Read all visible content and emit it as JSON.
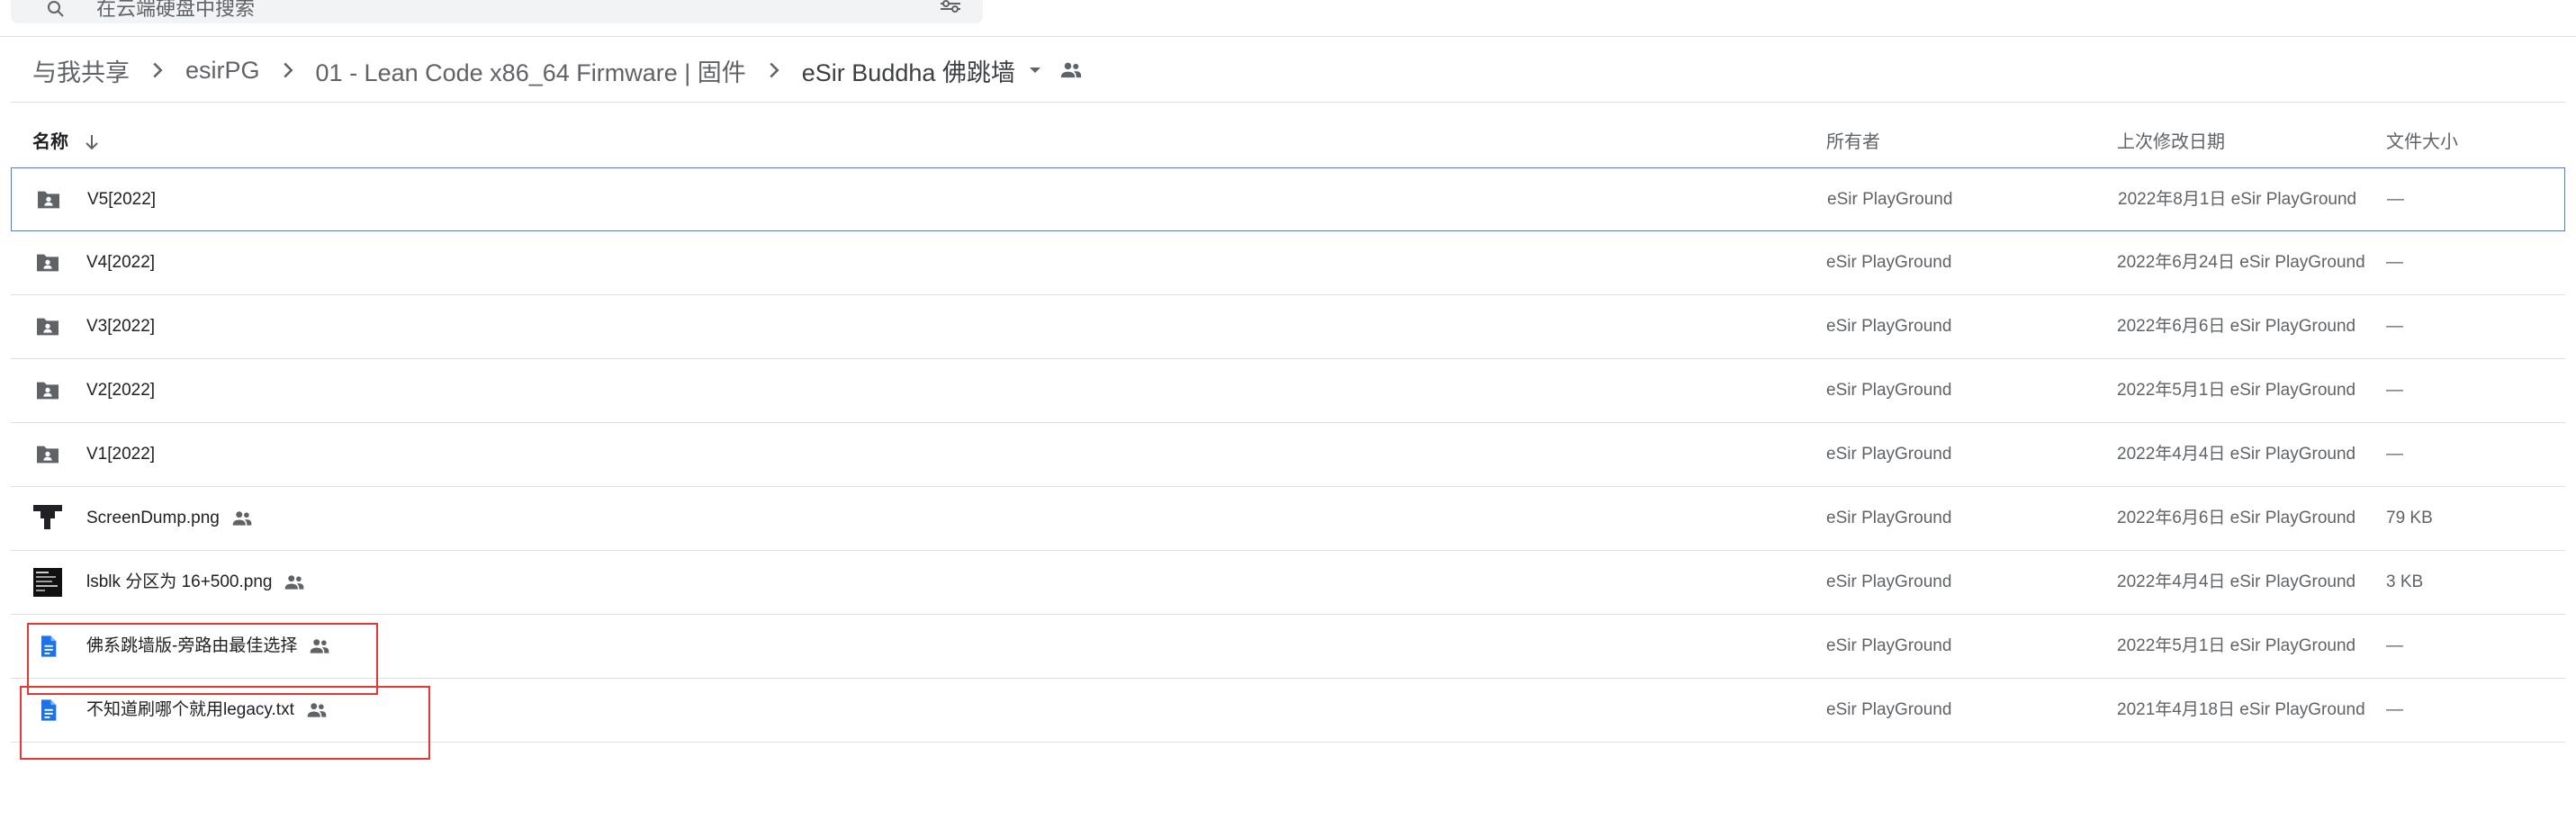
{
  "search": {
    "placeholder": "在云端硬盘中搜索"
  },
  "breadcrumb": {
    "items": [
      {
        "label": "与我共享"
      },
      {
        "label": "esirPG"
      },
      {
        "label": "01 - Lean Code x86_64 Firmware | 固件"
      },
      {
        "label": "eSir Buddha 佛跳墙"
      }
    ]
  },
  "table": {
    "headers": {
      "name": "名称",
      "owner": "所有者",
      "modified": "上次修改日期",
      "size": "文件大小"
    },
    "rows": [
      {
        "icon": "shared-folder-icon",
        "name": "V5[2022]",
        "shared": false,
        "owner": "eSir PlayGround",
        "modified": "2022年8月1日 eSir PlayGround",
        "size": "—",
        "selected": true
      },
      {
        "icon": "shared-folder-icon",
        "name": "V4[2022]",
        "shared": false,
        "owner": "eSir PlayGround",
        "modified": "2022年6月24日 eSir PlayGround",
        "size": "—"
      },
      {
        "icon": "shared-folder-icon",
        "name": "V3[2022]",
        "shared": false,
        "owner": "eSir PlayGround",
        "modified": "2022年6月6日 eSir PlayGround",
        "size": "—"
      },
      {
        "icon": "shared-folder-icon",
        "name": "V2[2022]",
        "shared": false,
        "owner": "eSir PlayGround",
        "modified": "2022年5月1日 eSir PlayGround",
        "size": "—"
      },
      {
        "icon": "shared-folder-icon",
        "name": "V1[2022]",
        "shared": false,
        "owner": "eSir PlayGround",
        "modified": "2022年4月4日 eSir PlayGround",
        "size": "—"
      },
      {
        "icon": "image-thumbnail-icon",
        "name": "ScreenDump.png",
        "shared": true,
        "owner": "eSir PlayGround",
        "modified": "2022年6月6日 eSir PlayGround",
        "size": "79 KB"
      },
      {
        "icon": "terminal-thumbnail-icon",
        "name": "lsblk 分区为 16+500.png",
        "shared": true,
        "owner": "eSir PlayGround",
        "modified": "2022年4月4日 eSir PlayGround",
        "size": "3 KB"
      },
      {
        "icon": "google-doc-icon",
        "name": "佛系跳墙版-旁路由最佳选择",
        "shared": true,
        "owner": "eSir PlayGround",
        "modified": "2022年5月1日 eSir PlayGround",
        "size": "—"
      },
      {
        "icon": "google-doc-icon",
        "name": "不知道刷哪个就用legacy.txt",
        "shared": true,
        "owner": "eSir PlayGround",
        "modified": "2021年4月18日 eSir PlayGround",
        "size": "—"
      }
    ]
  },
  "colors": {
    "accent": "#4b7ce0",
    "doc_blue": "#1a73e8",
    "folder_gray": "#5f6368",
    "highlight_red": "#e53935"
  }
}
